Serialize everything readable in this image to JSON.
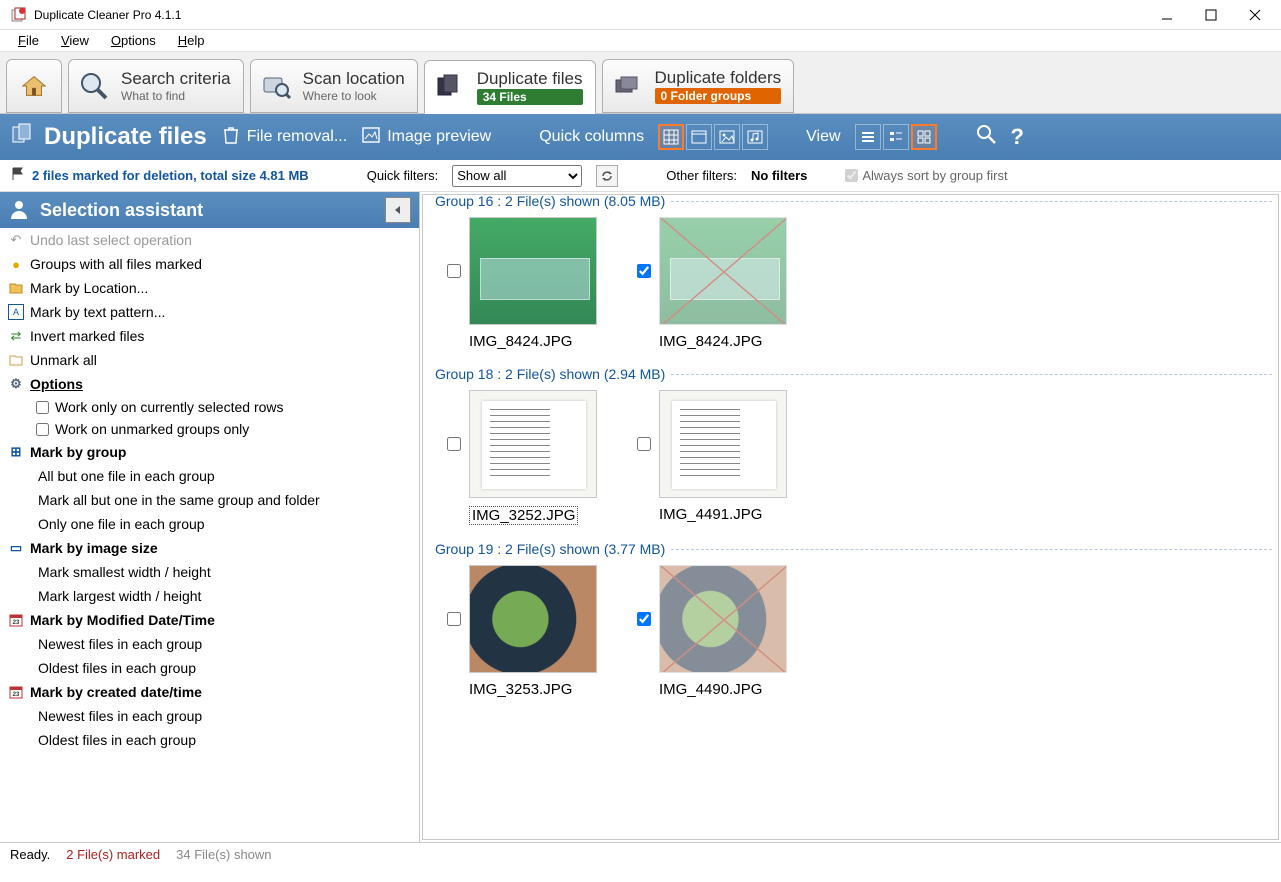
{
  "window": {
    "title": "Duplicate Cleaner Pro 4.1.1"
  },
  "menubar": [
    "File",
    "View",
    "Options",
    "Help"
  ],
  "tabs": {
    "search": {
      "title": "Search criteria",
      "sub": "What to find"
    },
    "scan": {
      "title": "Scan location",
      "sub": "Where to look"
    },
    "dupfiles": {
      "title": "Duplicate files",
      "badge": "34 Files"
    },
    "dupfold": {
      "title": "Duplicate folders",
      "badge": "0 Folder groups"
    }
  },
  "toolbar": {
    "title": "Duplicate files",
    "file_removal": "File removal...",
    "image_preview": "Image preview",
    "quick_columns": "Quick columns",
    "view": "View"
  },
  "filterbar": {
    "marked": "2 files marked for deletion, total size 4.81 MB",
    "quick_filters": "Quick filters:",
    "show_all": "Show all",
    "other_filters": "Other filters:",
    "no_filters": "No filters",
    "always_sort": "Always sort by group first"
  },
  "selection_assistant": {
    "title": "Selection assistant",
    "undo": "Undo last select operation",
    "groups_all_marked": "Groups with all files marked",
    "mark_location": "Mark by Location...",
    "mark_pattern": "Mark by text pattern...",
    "invert": "Invert marked files",
    "unmark_all": "Unmark all",
    "options": "Options",
    "opt1": "Work only on currently selected rows",
    "opt2": "Work on unmarked groups only",
    "mark_group": "Mark by group",
    "mg1": "All but one file in each group",
    "mg2": "Mark all but one in the same group and folder",
    "mg3": "Only one file in each group",
    "mark_imgsize": "Mark by image size",
    "mi1": "Mark smallest width / height",
    "mi2": "Mark largest width / height",
    "mark_moddate": "Mark by Modified Date/Time",
    "md1": "Newest files in each group",
    "md2": "Oldest files in each group",
    "mark_credate": "Mark by created date/time",
    "mc1": "Newest files in each group",
    "mc2": "Oldest files in each group"
  },
  "groups": [
    {
      "header": "Group 16  :  2 File(s) shown (8.05 MB)",
      "art": "art-garden",
      "items": [
        {
          "name": "IMG_8424.JPG",
          "checked": false,
          "selected": false
        },
        {
          "name": "IMG_8424.JPG",
          "checked": true,
          "selected": false
        }
      ]
    },
    {
      "header": "Group 18  :  2 File(s) shown (2.94 MB)",
      "art": "art-doc",
      "items": [
        {
          "name": "IMG_3252.JPG",
          "checked": false,
          "selected": true
        },
        {
          "name": "IMG_4491.JPG",
          "checked": false,
          "selected": false
        }
      ]
    },
    {
      "header": "Group 19  :  2 File(s) shown (3.77 MB)",
      "art": "art-food",
      "items": [
        {
          "name": "IMG_3253.JPG",
          "checked": false,
          "selected": false
        },
        {
          "name": "IMG_4490.JPG",
          "checked": true,
          "selected": false
        }
      ]
    }
  ],
  "statusbar": {
    "ready": "Ready.",
    "marked": "2 File(s) marked",
    "shown": "34 File(s) shown"
  }
}
